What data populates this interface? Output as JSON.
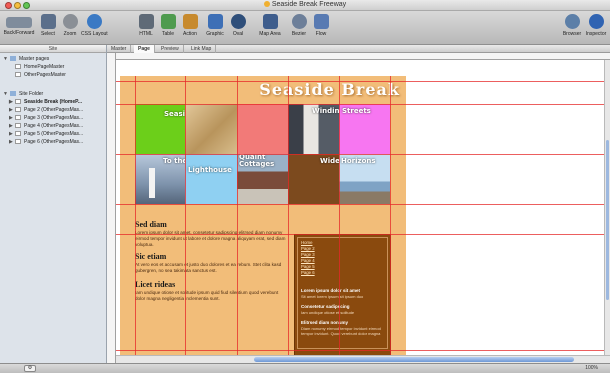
{
  "window": {
    "title": "Seaside Break Freeway",
    "traffic_lights": [
      "#f25b55",
      "#f6be3d",
      "#62c554"
    ]
  },
  "toolbar": {
    "items": [
      {
        "name": "back-forward",
        "label": "Back/Forward",
        "color": "#7f8c9c",
        "icon": "arrows-icon"
      },
      {
        "name": "select",
        "label": "Select",
        "color": "#5b6f8b",
        "icon": "cursor-icon"
      },
      {
        "name": "zoom",
        "label": "Zoom",
        "color": "#8a8f96",
        "icon": "magnifier-icon"
      },
      {
        "name": "css-layout",
        "label": "CSS Layout",
        "color": "#3a79c4",
        "icon": "globe-icon"
      },
      {
        "name": "html",
        "label": "HTML",
        "color": "#5f6a77",
        "icon": "html-icon"
      },
      {
        "name": "table",
        "label": "Table",
        "color": "#4f9b4f",
        "icon": "table-icon"
      },
      {
        "name": "action",
        "label": "Action",
        "color": "#c78a2e",
        "icon": "action-icon"
      },
      {
        "name": "graphic",
        "label": "Graphic",
        "color": "#3d6fb6",
        "icon": "graphic-icon"
      },
      {
        "name": "oval",
        "label": "Oval",
        "color": "#2f4f7a",
        "icon": "oval-icon"
      },
      {
        "name": "map-area",
        "label": "Map Area",
        "color": "#3e5d8c",
        "icon": "map-area-icon"
      },
      {
        "name": "bezier",
        "label": "Bezier",
        "color": "#6d7f99",
        "icon": "bezier-icon"
      },
      {
        "name": "flow",
        "label": "Flow",
        "color": "#587ab2",
        "icon": "flow-icon"
      },
      {
        "name": "browser",
        "label": "Browser",
        "color": "#5c7fa8",
        "icon": "browser-icon"
      },
      {
        "name": "inspector",
        "label": "Inspector",
        "color": "#2f63b2",
        "icon": "info-icon"
      }
    ]
  },
  "sidebar": {
    "header": "Site",
    "master_section": "Master pages",
    "masters": [
      "HomePageMaster",
      "OtherPagesMaster"
    ],
    "site_section": "Site Folder",
    "pages": [
      "Seaside Break (HomeP...",
      "Page 2 (OtherPagesMas...",
      "Page 3 (OtherPagesMas...",
      "Page 4 (OtherPagesMas...",
      "Page 5 (OtherPagesMas...",
      "Page 6 (OtherPagesMas..."
    ]
  },
  "view_tabs": [
    "Master",
    "Page",
    "Preview",
    "Link Map"
  ],
  "active_tab": "Page",
  "site_page": {
    "title": "Seaside Break",
    "grid": [
      {
        "label": "Seaside",
        "color": "#6ccf1a"
      },
      {
        "label": "",
        "color": "#d7b883"
      },
      {
        "label": "",
        "color": "#f27a78"
      },
      {
        "label": "Winding",
        "color": "#4a4f59"
      },
      {
        "label": "Streets",
        "color": "#f776f1"
      },
      {
        "label": "To the",
        "color": "#5a6f87"
      },
      {
        "label": "Lighthouse",
        "color": "#8fd0f2"
      },
      {
        "label": "Quaint Cottages",
        "color": "#6b5a55"
      },
      {
        "label": "Wide",
        "color": "#7c4a1e"
      },
      {
        "label": "Horizons",
        "color": "#9ec9ea"
      }
    ],
    "articles": [
      {
        "heading": "Sed diam",
        "text": "Lorem ipsum dolor sit amet, consetetur sadipscing elitrsed diam nonumy eirmod tempor invidunt ut labore et dolore magna aliquyam erat, sed diam voluptua."
      },
      {
        "heading": "Sic etiam",
        "text": "At vero eos et accusam et justo duo dolores et ea rebum. Stet clita kasd gubergren, no sea takimata sanctus est."
      },
      {
        "heading": "Licet rideas",
        "text": "Iam undique otiose et solitude ipsum quid fiud silentium quod verebunt dolor magna negligentia inclementia sunt."
      }
    ],
    "nav_links": [
      "Home",
      "Page 2",
      "Page 3",
      "Page 4",
      "Page 5",
      "Page 6"
    ],
    "side_items": [
      {
        "heading": "Lorem ipsum dolor sit amet",
        "text": "Sit amet lorem ipsum sit ipsum duo"
      },
      {
        "heading": "Consetetur sadipscing",
        "text": "Iam undique otiose et solitude"
      },
      {
        "heading": "Elitrsed diam nonumy",
        "text": "Diam nonumy eirmod tempor invidunt eirmod tempor invidunt. Quod verebunt dolor magna"
      }
    ],
    "colors": {
      "page_bg": "#f2bd79",
      "sidebar_box": "#8a4a0e"
    }
  },
  "status": {
    "zoom": "100%"
  }
}
